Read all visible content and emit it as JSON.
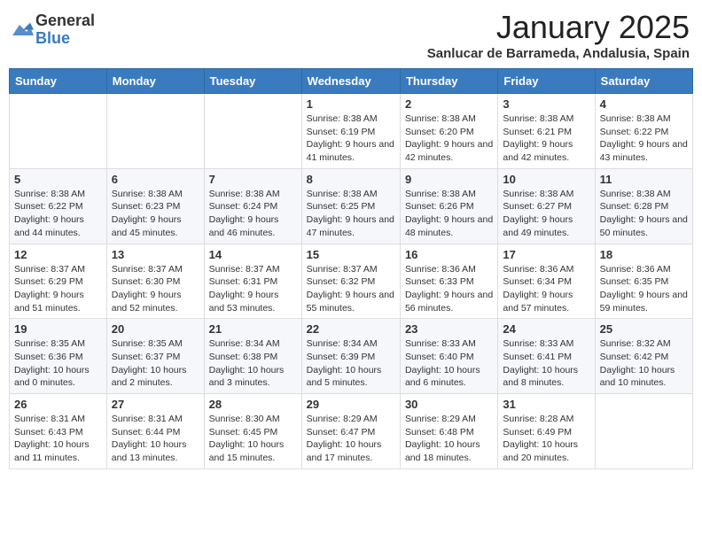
{
  "logo": {
    "general": "General",
    "blue": "Blue"
  },
  "header": {
    "month": "January 2025",
    "location": "Sanlucar de Barrameda, Andalusia, Spain"
  },
  "weekdays": [
    "Sunday",
    "Monday",
    "Tuesday",
    "Wednesday",
    "Thursday",
    "Friday",
    "Saturday"
  ],
  "weeks": [
    [
      null,
      null,
      null,
      {
        "day": 1,
        "sunrise": "8:38 AM",
        "sunset": "6:19 PM",
        "daylight": "9 hours and 41 minutes."
      },
      {
        "day": 2,
        "sunrise": "8:38 AM",
        "sunset": "6:20 PM",
        "daylight": "9 hours and 42 minutes."
      },
      {
        "day": 3,
        "sunrise": "8:38 AM",
        "sunset": "6:21 PM",
        "daylight": "9 hours and 42 minutes."
      },
      {
        "day": 4,
        "sunrise": "8:38 AM",
        "sunset": "6:22 PM",
        "daylight": "9 hours and 43 minutes."
      }
    ],
    [
      {
        "day": 5,
        "sunrise": "8:38 AM",
        "sunset": "6:22 PM",
        "daylight": "9 hours and 44 minutes."
      },
      {
        "day": 6,
        "sunrise": "8:38 AM",
        "sunset": "6:23 PM",
        "daylight": "9 hours and 45 minutes."
      },
      {
        "day": 7,
        "sunrise": "8:38 AM",
        "sunset": "6:24 PM",
        "daylight": "9 hours and 46 minutes."
      },
      {
        "day": 8,
        "sunrise": "8:38 AM",
        "sunset": "6:25 PM",
        "daylight": "9 hours and 47 minutes."
      },
      {
        "day": 9,
        "sunrise": "8:38 AM",
        "sunset": "6:26 PM",
        "daylight": "9 hours and 48 minutes."
      },
      {
        "day": 10,
        "sunrise": "8:38 AM",
        "sunset": "6:27 PM",
        "daylight": "9 hours and 49 minutes."
      },
      {
        "day": 11,
        "sunrise": "8:38 AM",
        "sunset": "6:28 PM",
        "daylight": "9 hours and 50 minutes."
      }
    ],
    [
      {
        "day": 12,
        "sunrise": "8:37 AM",
        "sunset": "6:29 PM",
        "daylight": "9 hours and 51 minutes."
      },
      {
        "day": 13,
        "sunrise": "8:37 AM",
        "sunset": "6:30 PM",
        "daylight": "9 hours and 52 minutes."
      },
      {
        "day": 14,
        "sunrise": "8:37 AM",
        "sunset": "6:31 PM",
        "daylight": "9 hours and 53 minutes."
      },
      {
        "day": 15,
        "sunrise": "8:37 AM",
        "sunset": "6:32 PM",
        "daylight": "9 hours and 55 minutes."
      },
      {
        "day": 16,
        "sunrise": "8:36 AM",
        "sunset": "6:33 PM",
        "daylight": "9 hours and 56 minutes."
      },
      {
        "day": 17,
        "sunrise": "8:36 AM",
        "sunset": "6:34 PM",
        "daylight": "9 hours and 57 minutes."
      },
      {
        "day": 18,
        "sunrise": "8:36 AM",
        "sunset": "6:35 PM",
        "daylight": "9 hours and 59 minutes."
      }
    ],
    [
      {
        "day": 19,
        "sunrise": "8:35 AM",
        "sunset": "6:36 PM",
        "daylight": "10 hours and 0 minutes."
      },
      {
        "day": 20,
        "sunrise": "8:35 AM",
        "sunset": "6:37 PM",
        "daylight": "10 hours and 2 minutes."
      },
      {
        "day": 21,
        "sunrise": "8:34 AM",
        "sunset": "6:38 PM",
        "daylight": "10 hours and 3 minutes."
      },
      {
        "day": 22,
        "sunrise": "8:34 AM",
        "sunset": "6:39 PM",
        "daylight": "10 hours and 5 minutes."
      },
      {
        "day": 23,
        "sunrise": "8:33 AM",
        "sunset": "6:40 PM",
        "daylight": "10 hours and 6 minutes."
      },
      {
        "day": 24,
        "sunrise": "8:33 AM",
        "sunset": "6:41 PM",
        "daylight": "10 hours and 8 minutes."
      },
      {
        "day": 25,
        "sunrise": "8:32 AM",
        "sunset": "6:42 PM",
        "daylight": "10 hours and 10 minutes."
      }
    ],
    [
      {
        "day": 26,
        "sunrise": "8:31 AM",
        "sunset": "6:43 PM",
        "daylight": "10 hours and 11 minutes."
      },
      {
        "day": 27,
        "sunrise": "8:31 AM",
        "sunset": "6:44 PM",
        "daylight": "10 hours and 13 minutes."
      },
      {
        "day": 28,
        "sunrise": "8:30 AM",
        "sunset": "6:45 PM",
        "daylight": "10 hours and 15 minutes."
      },
      {
        "day": 29,
        "sunrise": "8:29 AM",
        "sunset": "6:47 PM",
        "daylight": "10 hours and 17 minutes."
      },
      {
        "day": 30,
        "sunrise": "8:29 AM",
        "sunset": "6:48 PM",
        "daylight": "10 hours and 18 minutes."
      },
      {
        "day": 31,
        "sunrise": "8:28 AM",
        "sunset": "6:49 PM",
        "daylight": "10 hours and 20 minutes."
      },
      null
    ]
  ],
  "labels": {
    "sunrise": "Sunrise:",
    "sunset": "Sunset:",
    "daylight": "Daylight:"
  }
}
